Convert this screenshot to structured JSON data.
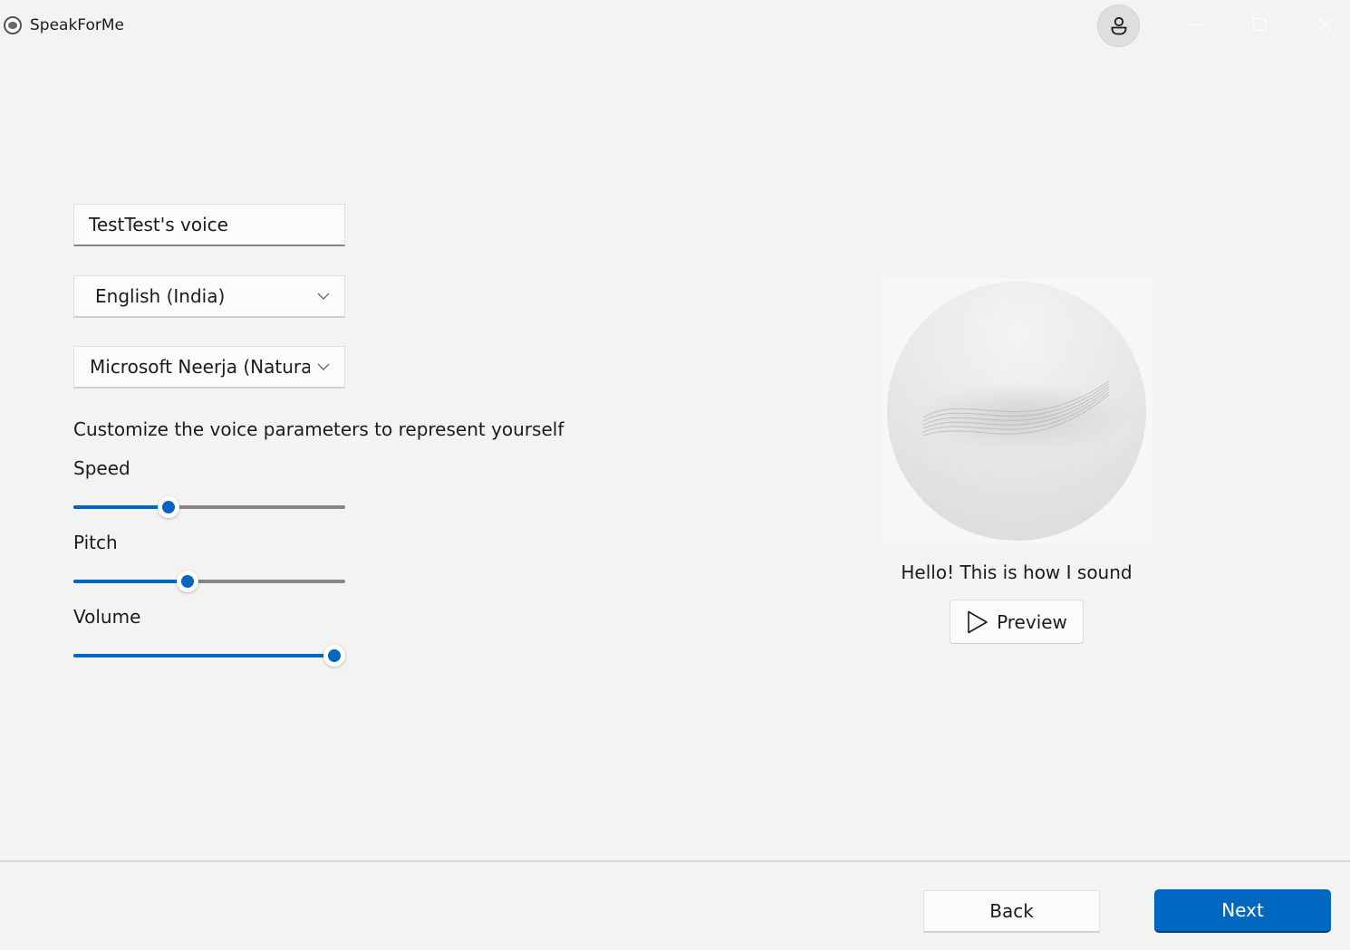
{
  "window": {
    "title": "SpeakForMe",
    "controls": {
      "minimize": "minimize-icon",
      "maximize": "maximize-icon",
      "close": "close-icon"
    },
    "account_icon": "person-icon"
  },
  "form": {
    "voice_name": {
      "value": "TestTest's voice"
    },
    "language": {
      "selected": "English (India)",
      "icon": "chevron-down-icon"
    },
    "voice": {
      "selected": "Microsoft Neerja (Natural",
      "icon": "chevron-down-icon"
    },
    "customize_hint": "Customize the voice parameters to represent yourself",
    "sliders": [
      {
        "label": "Speed",
        "value": 0.35
      },
      {
        "label": "Pitch",
        "value": 0.42
      },
      {
        "label": "Volume",
        "value": 0.96
      }
    ]
  },
  "preview": {
    "caption": "Hello! This is how I sound",
    "button_label": "Preview",
    "button_icon": "play-icon"
  },
  "footer": {
    "back_label": "Back",
    "next_label": "Next"
  },
  "colors": {
    "accent": "#0067c0",
    "background": "#f3f3f3",
    "track": "#868686"
  }
}
